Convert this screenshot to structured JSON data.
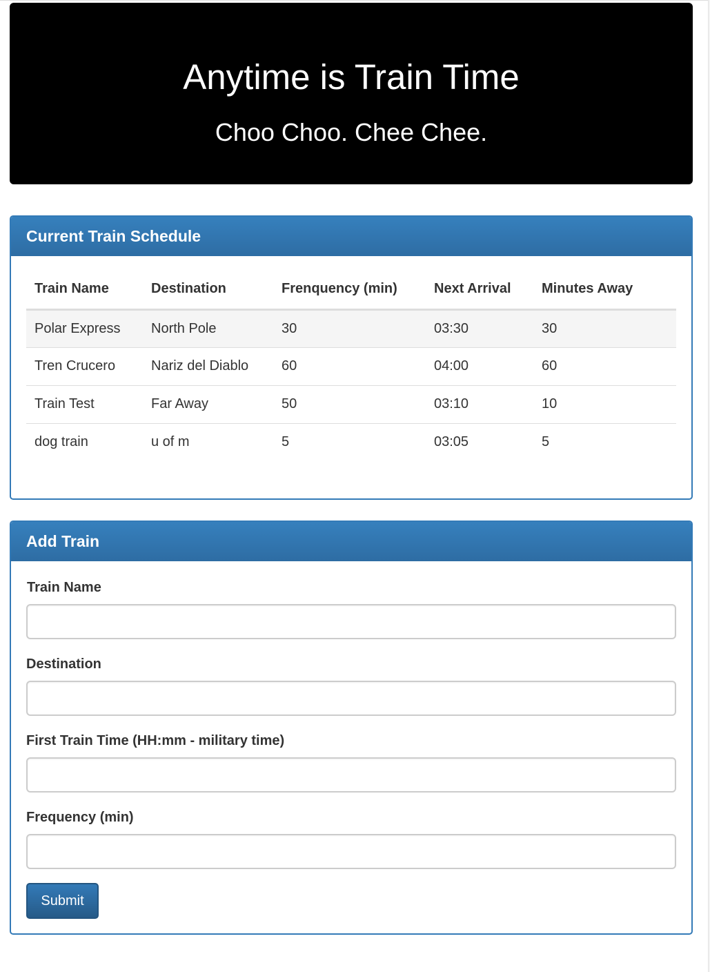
{
  "header": {
    "title": "Anytime is Train Time",
    "subtitle": "Choo Choo. Chee Chee."
  },
  "schedule_panel": {
    "title": "Current Train Schedule",
    "columns": [
      "Train Name",
      "Destination",
      "Frenquency (min)",
      "Next Arrival",
      "Minutes Away"
    ],
    "rows": [
      [
        "Polar Express",
        "North Pole",
        "30",
        "03:30",
        "30"
      ],
      [
        "Tren Crucero",
        "Nariz del Diablo",
        "60",
        "04:00",
        "60"
      ],
      [
        "Train Test",
        "Far Away",
        "50",
        "03:10",
        "10"
      ],
      [
        "dog train",
        "u of m",
        "5",
        "03:05",
        "5"
      ]
    ]
  },
  "add_panel": {
    "title": "Add Train",
    "fields": {
      "train_name": {
        "label": "Train Name",
        "value": ""
      },
      "destination": {
        "label": "Destination",
        "value": ""
      },
      "first_train_time": {
        "label": "First Train Time (HH:mm - military time)",
        "value": ""
      },
      "frequency": {
        "label": "Frequency (min)",
        "value": ""
      }
    },
    "submit_label": "Submit"
  },
  "colors": {
    "jumbotron_bg": "#000000",
    "panel_primary": "#337ab7",
    "striped_row": "#f5f5f5"
  }
}
